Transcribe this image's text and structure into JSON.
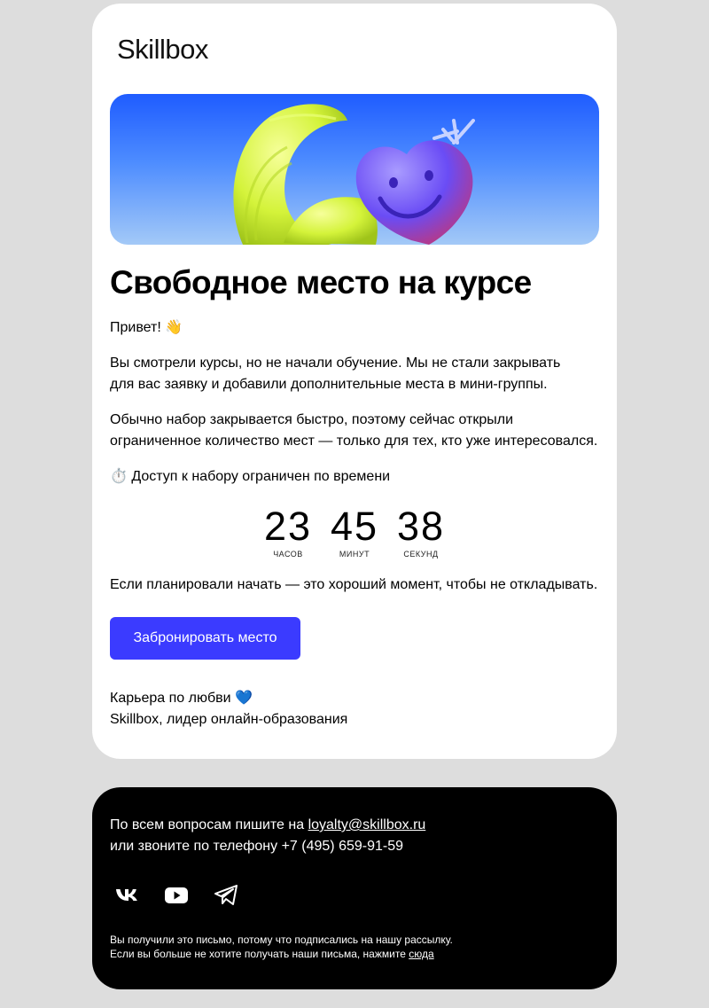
{
  "brand": {
    "logo_text": "Skillbox"
  },
  "email": {
    "headline": "Свободное место на курсе",
    "greeting": "Привет! 👋",
    "para1_line1": "Вы смотрели курсы, но не начали обучение. Мы не стали закрывать",
    "para1_line2": "для вас заявку и добавили дополнительные места в мини-группы.",
    "para2_line1": "Обычно набор закрывается быстро, поэтому сейчас открыли",
    "para2_line2": "ограниченное количество мест — только для тех, кто уже интересовался.",
    "limited_notice": "⏱️ Доступ к набору ограничен по времени",
    "timer": [
      {
        "value": "23",
        "label": "ЧАСОВ"
      },
      {
        "value": "45",
        "label": "МИНУТ"
      },
      {
        "value": "38",
        "label": "СЕКУНД"
      }
    ],
    "closing_line": "Если планировали начать — это хороший момент, чтобы не откладывать.",
    "cta_label": "Забронировать место",
    "signoff_line1": "Карьера по любви 💙",
    "signoff_line2": "Skillbox, лидер онлайн-образования"
  },
  "footer": {
    "contact_prefix": "По всем вопросам пишите на ",
    "contact_email": "loyalty@skillbox.ru",
    "contact_phone_line": "или звоните по телефону +7 (495) 659-91-59",
    "social_icons": [
      "vk-icon",
      "youtube-icon",
      "telegram-icon"
    ],
    "fine_line1": "Вы получили это письмо, потому что подписались на нашу рассылку.",
    "fine_line2_prefix": "Если вы больше не хотите получать наши письма, нажмите ",
    "unsubscribe_link": "сюда"
  },
  "colors": {
    "page_bg": "#dddddd",
    "card_bg": "#ffffff",
    "accent_button": "#3b3bff",
    "footer_bg": "#000000"
  }
}
